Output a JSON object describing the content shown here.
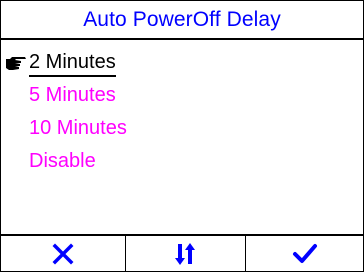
{
  "title": "Auto PowerOff Delay",
  "menu": {
    "items": [
      {
        "label": "2 Minutes",
        "selected": true
      },
      {
        "label": "5 Minutes",
        "selected": false
      },
      {
        "label": "10 Minutes",
        "selected": false
      },
      {
        "label": "Disable",
        "selected": false
      }
    ]
  },
  "softkeys": [
    {
      "icon": "close-icon",
      "action": "cancel"
    },
    {
      "icon": "sort-arrows-icon",
      "action": "move"
    },
    {
      "icon": "checkmark-icon",
      "action": "confirm"
    }
  ],
  "colors": {
    "title": "#0000ff",
    "option": "#ff00ff",
    "selected": "#000000",
    "softkey_icon": "#0000ff",
    "border": "#000000",
    "background": "#ffffff"
  }
}
